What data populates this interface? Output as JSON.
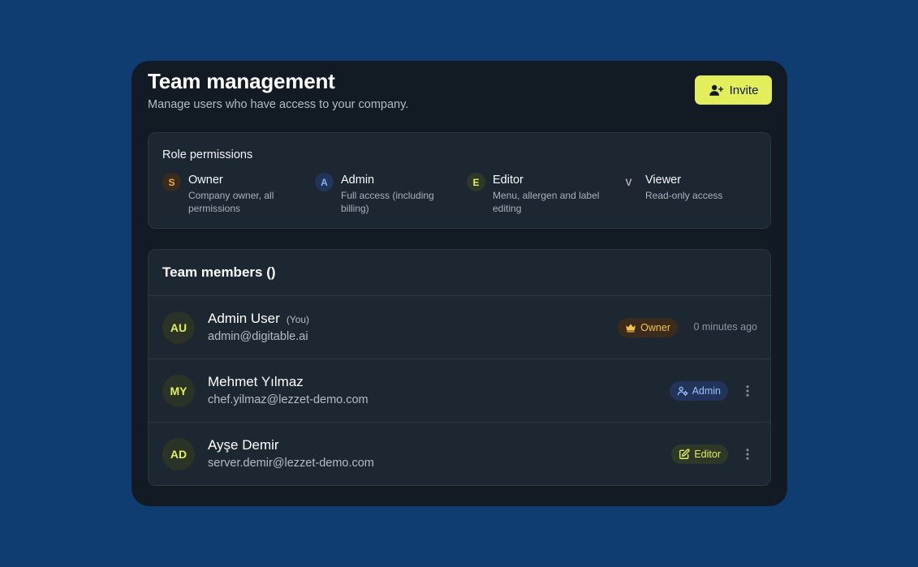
{
  "header": {
    "title": "Team management",
    "subtitle": "Manage users who have access to your company.",
    "invite_label": "Invite"
  },
  "roles": {
    "heading": "Role permissions",
    "items": [
      {
        "letter": "S",
        "name": "Owner",
        "description": "Company owner, all permissions",
        "badge_bg": "#3a2b1d",
        "badge_fg": "#f6a93b"
      },
      {
        "letter": "A",
        "name": "Admin",
        "description": "Full access (including billing)",
        "badge_bg": "#22345a",
        "badge_fg": "#7fb2f5"
      },
      {
        "letter": "E",
        "name": "Editor",
        "description": "Menu, allergen and label editing",
        "badge_bg": "#2d3826",
        "badge_fg": "#e2ef5b"
      },
      {
        "letter": "V",
        "name": "Viewer",
        "description": "Read-only access",
        "badge_bg": "#1f2630",
        "badge_fg": "#a8b1bd"
      }
    ]
  },
  "members": {
    "heading": "Team members ()",
    "rows": [
      {
        "initials": "AU",
        "name": "Admin User",
        "you": "(You)",
        "email": "admin@digitable.ai",
        "role": "Owner",
        "role_icon": "crown-icon",
        "time": "0 minutes ago"
      },
      {
        "initials": "MY",
        "name": "Mehmet Yılmaz",
        "email": "chef.yilmaz@lezzet-demo.com",
        "role": "Admin",
        "role_icon": "user-cog-icon"
      },
      {
        "initials": "AD",
        "name": "Ayşe Demir",
        "email": "server.demir@lezzet-demo.com",
        "role": "Editor",
        "role_icon": "edit-icon"
      }
    ]
  },
  "colors": {
    "background": "#0f3d72",
    "panel": "#121a23",
    "card": "#1d2732",
    "accent": "#e2ef5b"
  }
}
